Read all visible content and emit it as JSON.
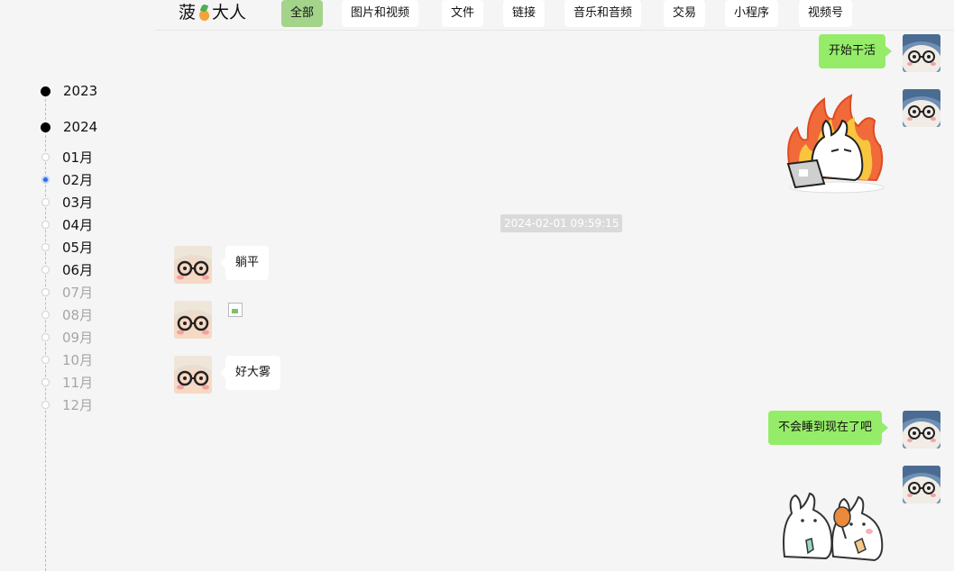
{
  "header": {
    "brand_left": "菠",
    "brand_right": "大人",
    "tabs": [
      {
        "label": "全部",
        "active": true
      },
      {
        "label": "图片和视频",
        "active": false
      },
      {
        "label": "文件",
        "active": false
      },
      {
        "label": "链接",
        "active": false
      },
      {
        "label": "音乐和音频",
        "active": false
      },
      {
        "label": "交易",
        "active": false
      },
      {
        "label": "小程序",
        "active": false
      },
      {
        "label": "视频号",
        "active": false
      }
    ]
  },
  "timeline": {
    "years": [
      "2023",
      "2024"
    ],
    "months": [
      {
        "label": "01月",
        "state": "enabled"
      },
      {
        "label": "02月",
        "state": "selected"
      },
      {
        "label": "03月",
        "state": "enabled"
      },
      {
        "label": "04月",
        "state": "enabled"
      },
      {
        "label": "05月",
        "state": "enabled"
      },
      {
        "label": "06月",
        "state": "enabled"
      },
      {
        "label": "07月",
        "state": "disabled"
      },
      {
        "label": "08月",
        "state": "disabled"
      },
      {
        "label": "09月",
        "state": "disabled"
      },
      {
        "label": "10月",
        "state": "disabled"
      },
      {
        "label": "11月",
        "state": "disabled"
      },
      {
        "label": "12月",
        "state": "disabled"
      }
    ]
  },
  "chat": {
    "messages": [
      {
        "sender": "me",
        "type": "text",
        "text": "开始干活"
      },
      {
        "sender": "me",
        "type": "sticker",
        "sticker": "rabbit-laptop-fire"
      },
      {
        "type": "timestamp",
        "text": "2024-02-01 09:59:15"
      },
      {
        "sender": "them",
        "type": "text",
        "text": "躺平"
      },
      {
        "sender": "them",
        "type": "image",
        "image": "broken-image"
      },
      {
        "sender": "them",
        "type": "text",
        "text": "好大雾"
      },
      {
        "sender": "me",
        "type": "text",
        "text": "不会睡到现在了吧"
      },
      {
        "sender": "me",
        "type": "sticker",
        "sticker": "two-rabbits-drumstick"
      }
    ]
  },
  "colors": {
    "background": "#f5f5f5",
    "my_bubble": "#95ec69",
    "their_bubble": "#ffffff",
    "active_tab": "#a4d38a",
    "selected_month": "#2e6be6",
    "disabled_month": "#a6a6a6"
  }
}
